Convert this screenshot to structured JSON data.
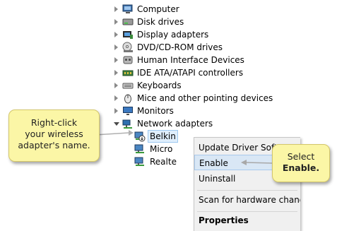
{
  "device_tree": {
    "categories": [
      {
        "label": "Computer",
        "icon": "computer-icon"
      },
      {
        "label": "Disk drives",
        "icon": "disk-drive-icon"
      },
      {
        "label": "Display adapters",
        "icon": "display-adapter-icon"
      },
      {
        "label": "DVD/CD-ROM drives",
        "icon": "dvd-drive-icon"
      },
      {
        "label": "Human Interface Devices",
        "icon": "hid-icon"
      },
      {
        "label": "IDE ATA/ATAPI controllers",
        "icon": "ide-controller-icon"
      },
      {
        "label": "Keyboards",
        "icon": "keyboard-icon"
      },
      {
        "label": "Mice and other pointing devices",
        "icon": "mouse-icon"
      },
      {
        "label": "Monitors",
        "icon": "monitor-icon"
      },
      {
        "label": "Network adapters",
        "icon": "network-adapter-icon",
        "expanded": true
      }
    ],
    "network_children": [
      {
        "label": "Belkin",
        "icon": "network-adapter-disabled-icon",
        "selected": true
      },
      {
        "label": "Micro",
        "icon": "network-adapter-icon"
      },
      {
        "label": "Realte",
        "icon": "network-adapter-icon"
      }
    ]
  },
  "context_menu": {
    "items": [
      {
        "label": "Update Driver Softw"
      },
      {
        "label": "Enable",
        "highlighted": true
      },
      {
        "label": "Uninstall"
      },
      {
        "label": "Scan for hardware changes"
      },
      {
        "label": "Properties",
        "bold": true
      }
    ]
  },
  "callouts": {
    "left": {
      "line1": "Right-click",
      "line2": "your wireless",
      "line3": "adapter's name."
    },
    "right": {
      "line1": "Select",
      "line2": "Enable."
    }
  },
  "colors": {
    "callout_bg": "#fbf6a6",
    "callout_border": "#d4c76a",
    "menu_bg": "#f0f0f0",
    "highlight": "#d9e7f5"
  }
}
